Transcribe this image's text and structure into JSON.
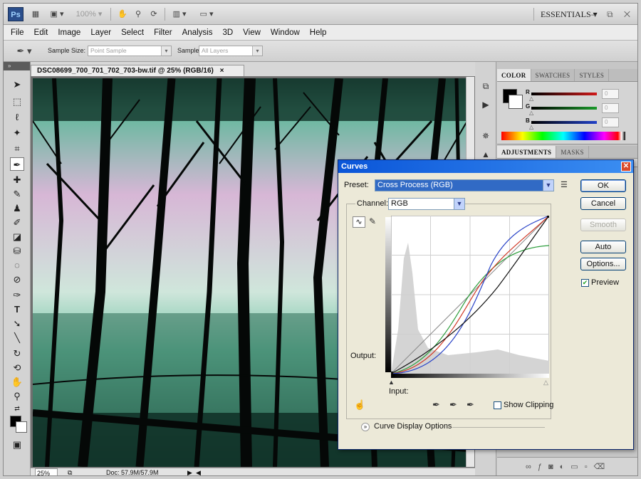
{
  "app": {
    "logo": "Ps",
    "zoom_level": "100% ▾",
    "workspace": "ESSENTIALS ▾",
    "window_controls": "– ⧉ ✕"
  },
  "menu": [
    "File",
    "Edit",
    "Image",
    "Layer",
    "Select",
    "Filter",
    "Analysis",
    "3D",
    "View",
    "Window",
    "Help"
  ],
  "options_bar": {
    "sample_size_label": "Sample Size:",
    "sample_size_value": "Point Sample",
    "sample_label": "Sample:",
    "sample_value": "All Layers"
  },
  "document": {
    "tab_title": "DSC08699_700_701_702_703-bw.tif @ 25% (RGB/16)",
    "close_glyph": "×",
    "status_zoom": "25%",
    "status_doc": "Doc: 57.9M/57.9M"
  },
  "panels": {
    "color_tabs": [
      "COLOR",
      "SWATCHES",
      "STYLES"
    ],
    "adjust_tabs": [
      "ADJUSTMENTS",
      "MASKS"
    ],
    "channels": [
      {
        "label": "R",
        "value": "0",
        "color": "#d01818"
      },
      {
        "label": "G",
        "value": "0",
        "color": "#1a9a2a"
      },
      {
        "label": "B",
        "value": "0",
        "color": "#2040c8"
      }
    ]
  },
  "curves": {
    "title": "Curves",
    "preset_label": "Preset:",
    "preset_value": "Cross Process (RGB)",
    "channel_label": "Channel:",
    "channel_value": "RGB",
    "output_label": "Output:",
    "input_label": "Input:",
    "show_clipping_label": "Show Clipping",
    "show_clipping_checked": false,
    "display_options_label": "Curve Display Options",
    "buttons": {
      "ok": "OK",
      "cancel": "Cancel",
      "smooth": "Smooth",
      "auto": "Auto",
      "options": "Options..."
    },
    "preview_label": "Preview",
    "preview_checked": true
  }
}
